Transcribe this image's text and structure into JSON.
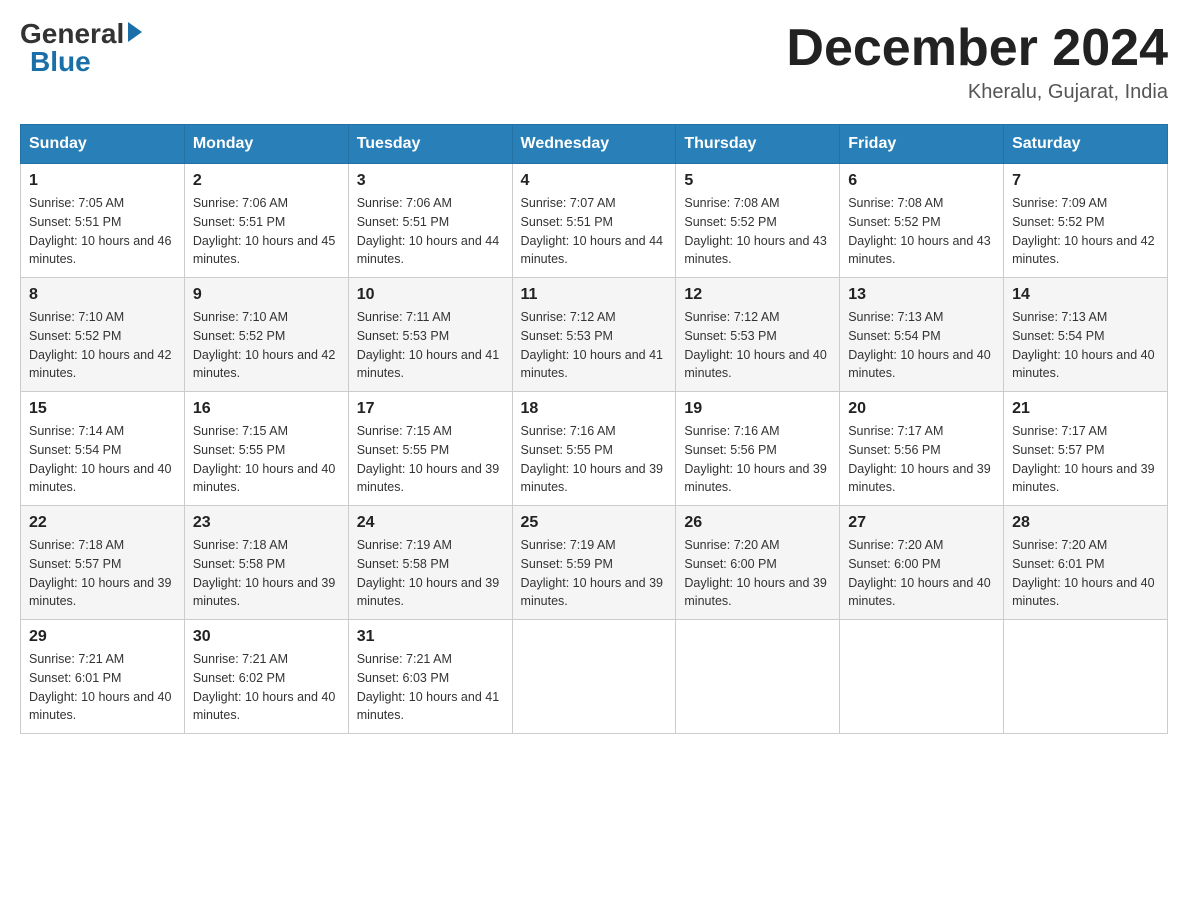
{
  "header": {
    "logo_general": "General",
    "logo_blue": "Blue",
    "month_title": "December 2024",
    "location": "Kheralu, Gujarat, India"
  },
  "weekdays": [
    "Sunday",
    "Monday",
    "Tuesday",
    "Wednesday",
    "Thursday",
    "Friday",
    "Saturday"
  ],
  "weeks": [
    [
      {
        "day": "1",
        "sunrise": "7:05 AM",
        "sunset": "5:51 PM",
        "daylight": "10 hours and 46 minutes."
      },
      {
        "day": "2",
        "sunrise": "7:06 AM",
        "sunset": "5:51 PM",
        "daylight": "10 hours and 45 minutes."
      },
      {
        "day": "3",
        "sunrise": "7:06 AM",
        "sunset": "5:51 PM",
        "daylight": "10 hours and 44 minutes."
      },
      {
        "day": "4",
        "sunrise": "7:07 AM",
        "sunset": "5:51 PM",
        "daylight": "10 hours and 44 minutes."
      },
      {
        "day": "5",
        "sunrise": "7:08 AM",
        "sunset": "5:52 PM",
        "daylight": "10 hours and 43 minutes."
      },
      {
        "day": "6",
        "sunrise": "7:08 AM",
        "sunset": "5:52 PM",
        "daylight": "10 hours and 43 minutes."
      },
      {
        "day": "7",
        "sunrise": "7:09 AM",
        "sunset": "5:52 PM",
        "daylight": "10 hours and 42 minutes."
      }
    ],
    [
      {
        "day": "8",
        "sunrise": "7:10 AM",
        "sunset": "5:52 PM",
        "daylight": "10 hours and 42 minutes."
      },
      {
        "day": "9",
        "sunrise": "7:10 AM",
        "sunset": "5:52 PM",
        "daylight": "10 hours and 42 minutes."
      },
      {
        "day": "10",
        "sunrise": "7:11 AM",
        "sunset": "5:53 PM",
        "daylight": "10 hours and 41 minutes."
      },
      {
        "day": "11",
        "sunrise": "7:12 AM",
        "sunset": "5:53 PM",
        "daylight": "10 hours and 41 minutes."
      },
      {
        "day": "12",
        "sunrise": "7:12 AM",
        "sunset": "5:53 PM",
        "daylight": "10 hours and 40 minutes."
      },
      {
        "day": "13",
        "sunrise": "7:13 AM",
        "sunset": "5:54 PM",
        "daylight": "10 hours and 40 minutes."
      },
      {
        "day": "14",
        "sunrise": "7:13 AM",
        "sunset": "5:54 PM",
        "daylight": "10 hours and 40 minutes."
      }
    ],
    [
      {
        "day": "15",
        "sunrise": "7:14 AM",
        "sunset": "5:54 PM",
        "daylight": "10 hours and 40 minutes."
      },
      {
        "day": "16",
        "sunrise": "7:15 AM",
        "sunset": "5:55 PM",
        "daylight": "10 hours and 40 minutes."
      },
      {
        "day": "17",
        "sunrise": "7:15 AM",
        "sunset": "5:55 PM",
        "daylight": "10 hours and 39 minutes."
      },
      {
        "day": "18",
        "sunrise": "7:16 AM",
        "sunset": "5:55 PM",
        "daylight": "10 hours and 39 minutes."
      },
      {
        "day": "19",
        "sunrise": "7:16 AM",
        "sunset": "5:56 PM",
        "daylight": "10 hours and 39 minutes."
      },
      {
        "day": "20",
        "sunrise": "7:17 AM",
        "sunset": "5:56 PM",
        "daylight": "10 hours and 39 minutes."
      },
      {
        "day": "21",
        "sunrise": "7:17 AM",
        "sunset": "5:57 PM",
        "daylight": "10 hours and 39 minutes."
      }
    ],
    [
      {
        "day": "22",
        "sunrise": "7:18 AM",
        "sunset": "5:57 PM",
        "daylight": "10 hours and 39 minutes."
      },
      {
        "day": "23",
        "sunrise": "7:18 AM",
        "sunset": "5:58 PM",
        "daylight": "10 hours and 39 minutes."
      },
      {
        "day": "24",
        "sunrise": "7:19 AM",
        "sunset": "5:58 PM",
        "daylight": "10 hours and 39 minutes."
      },
      {
        "day": "25",
        "sunrise": "7:19 AM",
        "sunset": "5:59 PM",
        "daylight": "10 hours and 39 minutes."
      },
      {
        "day": "26",
        "sunrise": "7:20 AM",
        "sunset": "6:00 PM",
        "daylight": "10 hours and 39 minutes."
      },
      {
        "day": "27",
        "sunrise": "7:20 AM",
        "sunset": "6:00 PM",
        "daylight": "10 hours and 40 minutes."
      },
      {
        "day": "28",
        "sunrise": "7:20 AM",
        "sunset": "6:01 PM",
        "daylight": "10 hours and 40 minutes."
      }
    ],
    [
      {
        "day": "29",
        "sunrise": "7:21 AM",
        "sunset": "6:01 PM",
        "daylight": "10 hours and 40 minutes."
      },
      {
        "day": "30",
        "sunrise": "7:21 AM",
        "sunset": "6:02 PM",
        "daylight": "10 hours and 40 minutes."
      },
      {
        "day": "31",
        "sunrise": "7:21 AM",
        "sunset": "6:03 PM",
        "daylight": "10 hours and 41 minutes."
      },
      null,
      null,
      null,
      null
    ]
  ],
  "labels": {
    "sunrise": "Sunrise:",
    "sunset": "Sunset:",
    "daylight": "Daylight:"
  }
}
